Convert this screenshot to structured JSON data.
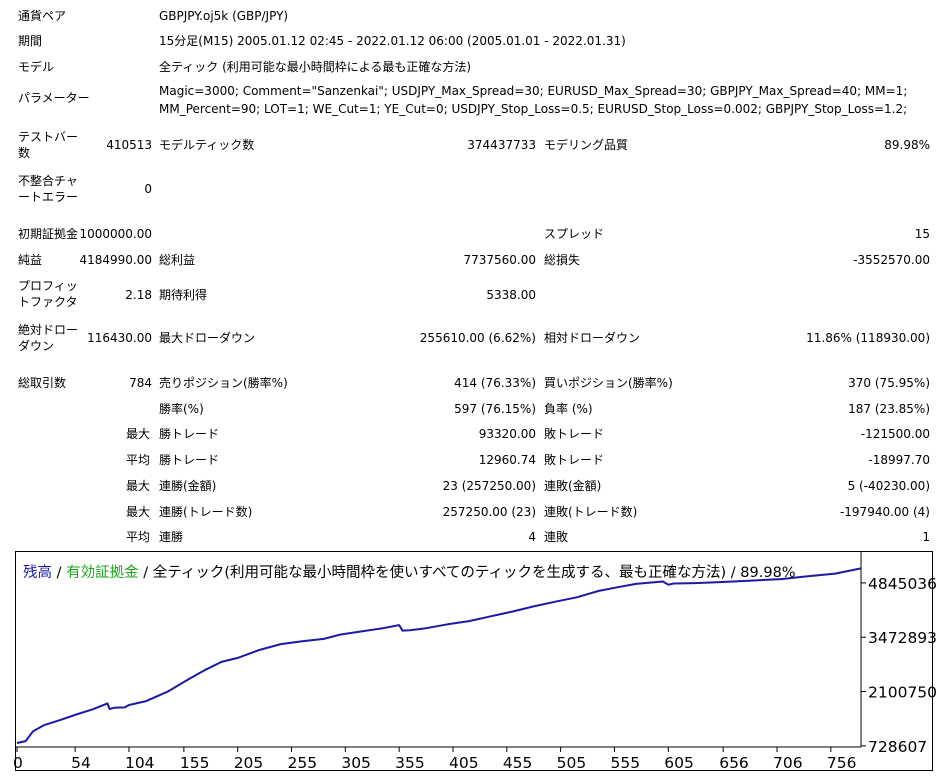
{
  "report": {
    "symbol_label": "通貨ペア",
    "symbol_value": "GBPJPY.oj5k (GBP/JPY)",
    "period_label": "期間",
    "period_value": "15分足(M15) 2005.01.12 02:45 - 2022.01.12 06:00 (2005.01.01 - 2022.01.31)",
    "model_label": "モデル",
    "model_value": "全ティック (利用可能な最小時間枠による最も正確な方法)",
    "params_label": "パラメーター",
    "params_value": "Magic=3000; Comment=\"Sanzenkai\"; USDJPY_Max_Spread=30; EURUSD_Max_Spread=30; GBPJPY_Max_Spread=40; MM=1; MM_Percent=90; LOT=1; WE_Cut=1; YE_Cut=0; USDJPY_Stop_Loss=0.5; EURUSD_Stop_Loss=0.002; GBPJPY_Stop_Loss=1.2;",
    "bars_label": "テストバー数",
    "bars_value": "410513",
    "ticks_label": "モデルティック数",
    "ticks_value": "374437733",
    "quality_label": "モデリング品質",
    "quality_value": "89.98%",
    "mismatch_label": "不整合チャートエラー",
    "mismatch_value": "0",
    "deposit_label": "初期証拠金",
    "deposit_value": "1000000.00",
    "spread_label": "スプレッド",
    "spread_value": "15",
    "net_label": "純益",
    "net_value": "4184990.00",
    "gross_profit_label": "総利益",
    "gross_profit_value": "7737560.00",
    "gross_loss_label": "総損失",
    "gross_loss_value": "-3552570.00",
    "pf_label": "プロフィットファクタ",
    "pf_value": "2.18",
    "expected_label": "期待利得",
    "expected_value": "5338.00",
    "abs_dd_label": "絶対ドローダウン",
    "abs_dd_value": "116430.00",
    "max_dd_label": "最大ドローダウン",
    "max_dd_value": "255610.00 (6.62%)",
    "rel_dd_label": "相対ドローダウン",
    "rel_dd_value": "11.86% (118930.00)",
    "trades_label": "総取引数",
    "trades_value": "784",
    "short_label": "売りポジション(勝率%)",
    "short_value": "414 (76.33%)",
    "long_label": "買いポジション(勝率%)",
    "long_value": "370 (75.95%)",
    "win_rate_label": "勝率(%)",
    "win_rate_value": "597 (76.15%)",
    "loss_rate_label": "負率 (%)",
    "loss_rate_value": "187 (23.85%)",
    "max_label": "最大",
    "avg_label": "平均",
    "largest_win_label": "勝トレード",
    "largest_win_value": "93320.00",
    "largest_loss_label": "敗トレード",
    "largest_loss_value": "-121500.00",
    "avg_win_label": "勝トレード",
    "avg_win_value": "12960.74",
    "avg_loss_label": "敗トレード",
    "avg_loss_value": "-18997.70",
    "max_consec_wins_label": "連勝(金額)",
    "max_consec_wins_value": "23 (257250.00)",
    "max_consec_losses_label": "連敗(金額)",
    "max_consec_losses_value": "5 (-40230.00)",
    "max_consec_profit_label": "連勝(トレード数)",
    "max_consec_profit_value": "257250.00 (23)",
    "max_consec_loss_label": "連敗(トレード数)",
    "max_consec_loss_value": "-197940.00 (4)",
    "avg_consec_wins_label": "連勝",
    "avg_consec_wins_value": "4",
    "avg_consec_losses_label": "連敗",
    "avg_consec_losses_value": "1"
  },
  "chart_data": {
    "type": "line",
    "legend": {
      "balance": "残高",
      "separator1": " / ",
      "equity": "有効証拠金",
      "rest": " / 全ティック(利用可能な最小時間枠を使いすべてのティックを生成する、最も正確な方法) / 89.98%"
    },
    "colors": {
      "balance": "#1a1aa6",
      "equity": "#1aa61a",
      "line": "#1a1aa6",
      "axis": "#000000"
    },
    "x_ticks": [
      0,
      54,
      104,
      155,
      205,
      255,
      305,
      355,
      405,
      455,
      505,
      555,
      605,
      656,
      706,
      756
    ],
    "x_tick_labels": [
      "0",
      "54",
      "104",
      "155",
      "205",
      "255",
      "305",
      "355",
      "405",
      "455",
      "505",
      "555",
      "605",
      "656",
      "706",
      "756"
    ],
    "y_ticks": [
      728607,
      2100750,
      3472893,
      4845036
    ],
    "y_tick_labels": [
      "728607",
      "2100750",
      "3472893",
      "4845036"
    ],
    "xlim": [
      0,
      784
    ],
    "ylim": [
      700000,
      5600000
    ],
    "series": [
      {
        "x": [
          0,
          8,
          15,
          25,
          40,
          55,
          70,
          84,
          86,
          90,
          100,
          104,
          120,
          140,
          160,
          175,
          190,
          205,
          225,
          245,
          265,
          285,
          300,
          320,
          340,
          355,
          358,
          365,
          380,
          400,
          420,
          440,
          460,
          480,
          500,
          520,
          540,
          555,
          575,
          600,
          605,
          610,
          630,
          650,
          680,
          710,
          730,
          760,
          784
        ],
        "y": [
          800000,
          850000,
          1100000,
          1250000,
          1380000,
          1520000,
          1650000,
          1800000,
          1660000,
          1690000,
          1700000,
          1760000,
          1860000,
          2100000,
          2420000,
          2650000,
          2850000,
          2950000,
          3150000,
          3300000,
          3370000,
          3430000,
          3540000,
          3620000,
          3700000,
          3780000,
          3640000,
          3650000,
          3700000,
          3800000,
          3880000,
          4000000,
          4120000,
          4250000,
          4370000,
          4480000,
          4640000,
          4720000,
          4820000,
          4880000,
          4800000,
          4830000,
          4840000,
          4860000,
          4900000,
          4940000,
          5000000,
          5080000,
          5210000
        ]
      }
    ]
  }
}
